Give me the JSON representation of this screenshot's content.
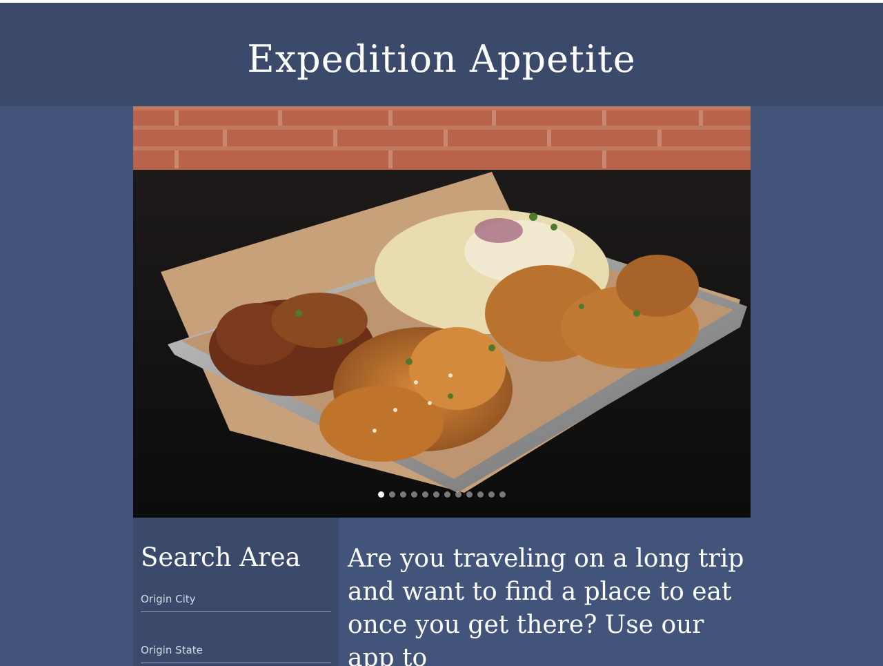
{
  "header": {
    "title": "Expedition Appetite"
  },
  "carousel": {
    "image_label": "fried chicken platter",
    "slide_count": 12,
    "active_index": 0
  },
  "search": {
    "title": "Search Area",
    "origin_city_placeholder": "Origin City",
    "origin_state_placeholder": "Origin State"
  },
  "intro": {
    "text": "Are you traveling on a long trip and want to find a place to eat once you get there? Use our app to"
  },
  "colors": {
    "header_bg": "#3b4a6b",
    "page_bg": "#43547b",
    "sidebar_bg": "#3b4a6b",
    "text": "#ffffff"
  }
}
